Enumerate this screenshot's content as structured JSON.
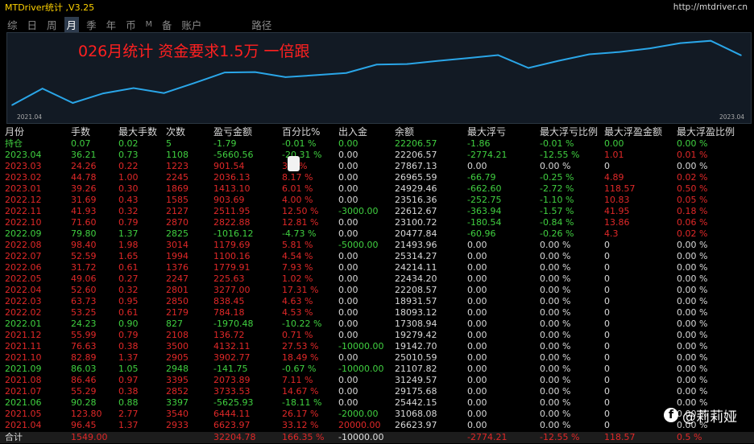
{
  "window": {
    "title": "MTDriver统计 ,V3.25",
    "url": "http://mtdriver.cn"
  },
  "tabs": [
    {
      "label": "综",
      "active": false,
      "small": false
    },
    {
      "label": "日",
      "active": false,
      "small": false
    },
    {
      "label": "周",
      "active": false,
      "small": false
    },
    {
      "label": "月",
      "active": true,
      "small": false
    },
    {
      "label": "季",
      "active": false,
      "small": false
    },
    {
      "label": "年",
      "active": false,
      "small": false
    },
    {
      "label": "币",
      "active": false,
      "small": false
    },
    {
      "label": "M",
      "active": false,
      "small": true
    },
    {
      "label": "备",
      "active": false,
      "small": false
    },
    {
      "label": "账户",
      "active": false,
      "small": false
    },
    {
      "label": "路径",
      "active": false,
      "small": false
    }
  ],
  "chart_data": {
    "type": "line",
    "title": "026月统计 资金要求1.5万 一倍跟",
    "x_start_label": "2021.04",
    "x_end_label": "2023.04",
    "line_color": "#2aa6e8",
    "x": [
      "2021.04",
      "2021.05",
      "2021.06",
      "2021.07",
      "2021.08",
      "2021.09",
      "2021.10",
      "2021.11",
      "2021.12",
      "2022.01",
      "2022.02",
      "2022.03",
      "2022.04",
      "2022.05",
      "2022.06",
      "2022.07",
      "2022.08",
      "2022.09",
      "2022.10",
      "2022.11",
      "2022.12",
      "2023.01",
      "2023.02",
      "2023.03",
      "2023.04"
    ],
    "values": [
      6623.97,
      13068.08,
      7442.15,
      11175.68,
      13249.6,
      11325.43,
      15228.17,
      19360.28,
      19497.14,
      17526.66,
      18311.54,
      19149.99,
      22427.06,
      22652.82,
      23832.75,
      24933.81,
      26113.47,
      21113.47,
      23936.35,
      26448.3,
      27352.23,
      28765.58,
      30801.71,
      31703.25,
      26042.69
    ],
    "ylim": [
      4000,
      33500
    ]
  },
  "table": {
    "headers": [
      "月份",
      "手数",
      "最大手数",
      "次数",
      "盈亏金额",
      "百分比%",
      "出入金",
      "余额",
      "最大浮亏",
      "最大浮亏比例",
      "最大浮盈金额",
      "最大浮盈比例"
    ],
    "holding": [
      "持仓",
      "0.07",
      "0.02",
      "5",
      "-1.79",
      "-0.01 %",
      "0.00",
      "22206.57",
      "-1.86",
      "-0.01 %",
      "0.00",
      "0.00 %"
    ],
    "rows": [
      {
        "sign": "neg",
        "cells": [
          "2023.04",
          "36.21",
          "0.73",
          "1108",
          "-5660.56",
          "-20.31 %",
          "0.00",
          "22206.57",
          "-2774.21",
          "-12.55 %",
          "1.01",
          "0.01 %"
        ]
      },
      {
        "sign": "pos",
        "cells": [
          "2023.03",
          "24.26",
          "0.22",
          "1223",
          "901.54",
          "3.3 %",
          "0.00",
          "27867.13",
          "0.00",
          "0.00 %",
          "0",
          "0.00 %"
        ]
      },
      {
        "sign": "pos",
        "cells": [
          "2023.02",
          "44.78",
          "1.00",
          "2245",
          "2036.13",
          "8.17 %",
          "0.00",
          "26965.59",
          "-66.79",
          "-0.25 %",
          "4.89",
          "0.02 %"
        ]
      },
      {
        "sign": "pos",
        "cells": [
          "2023.01",
          "39.26",
          "0.30",
          "1869",
          "1413.10",
          "6.01 %",
          "0.00",
          "24929.46",
          "-662.60",
          "-2.72 %",
          "118.57",
          "0.50 %"
        ]
      },
      {
        "sign": "pos",
        "cells": [
          "2022.12",
          "31.69",
          "0.43",
          "1585",
          "903.69",
          "4.00 %",
          "0.00",
          "23516.36",
          "-252.75",
          "-1.10 %",
          "10.83",
          "0.05 %"
        ]
      },
      {
        "sign": "pos",
        "cells": [
          "2022.11",
          "41.93",
          "0.32",
          "2127",
          "2511.95",
          "12.50 %",
          "-3000.00",
          "22612.67",
          "-363.94",
          "-1.57 %",
          "41.95",
          "0.18 %"
        ]
      },
      {
        "sign": "pos",
        "cells": [
          "2022.10",
          "71.60",
          "0.79",
          "2870",
          "2822.88",
          "12.81 %",
          "0.00",
          "23100.72",
          "-180.54",
          "-0.84 %",
          "13.86",
          "0.06 %"
        ]
      },
      {
        "sign": "neg",
        "cells": [
          "2022.09",
          "79.80",
          "1.37",
          "2825",
          "-1016.12",
          "-4.73 %",
          "0.00",
          "20477.84",
          "-60.96",
          "-0.26 %",
          "4.3",
          "0.02 %"
        ]
      },
      {
        "sign": "pos",
        "cells": [
          "2022.08",
          "98.40",
          "1.98",
          "3014",
          "1179.69",
          "5.81 %",
          "-5000.00",
          "21493.96",
          "0.00",
          "0.00 %",
          "0",
          "0.00 %"
        ]
      },
      {
        "sign": "pos",
        "cells": [
          "2022.07",
          "52.59",
          "1.65",
          "1994",
          "1100.16",
          "4.54 %",
          "0.00",
          "25314.27",
          "0.00",
          "0.00 %",
          "0",
          "0.00 %"
        ]
      },
      {
        "sign": "pos",
        "cells": [
          "2022.06",
          "31.72",
          "0.61",
          "1376",
          "1779.91",
          "7.93 %",
          "0.00",
          "24214.11",
          "0.00",
          "0.00 %",
          "0",
          "0.00 %"
        ]
      },
      {
        "sign": "pos",
        "cells": [
          "2022.05",
          "49.06",
          "0.27",
          "2247",
          "225.63",
          "1.02 %",
          "0.00",
          "22434.20",
          "0.00",
          "0.00 %",
          "0",
          "0.00 %"
        ]
      },
      {
        "sign": "pos",
        "cells": [
          "2022.04",
          "52.60",
          "0.32",
          "2801",
          "3277.00",
          "17.31 %",
          "0.00",
          "22208.57",
          "0.00",
          "0.00 %",
          "0",
          "0.00 %"
        ]
      },
      {
        "sign": "pos",
        "cells": [
          "2022.03",
          "63.73",
          "0.95",
          "2850",
          "838.45",
          "4.63 %",
          "0.00",
          "18931.57",
          "0.00",
          "0.00 %",
          "0",
          "0.00 %"
        ]
      },
      {
        "sign": "pos",
        "cells": [
          "2022.02",
          "53.25",
          "0.61",
          "2179",
          "784.18",
          "4.53 %",
          "0.00",
          "18093.12",
          "0.00",
          "0.00 %",
          "0",
          "0.00 %"
        ]
      },
      {
        "sign": "neg",
        "cells": [
          "2022.01",
          "24.23",
          "0.90",
          "827",
          "-1970.48",
          "-10.22 %",
          "0.00",
          "17308.94",
          "0.00",
          "0.00 %",
          "0",
          "0.00 %"
        ]
      },
      {
        "sign": "pos",
        "cells": [
          "2021.12",
          "55.99",
          "0.79",
          "2108",
          "136.72",
          "0.71 %",
          "0.00",
          "19279.42",
          "0.00",
          "0.00 %",
          "0",
          "0.00 %"
        ]
      },
      {
        "sign": "pos",
        "cells": [
          "2021.11",
          "76.63",
          "0.38",
          "3500",
          "4132.11",
          "27.53 %",
          "-10000.00",
          "19142.70",
          "0.00",
          "0.00 %",
          "0",
          "0.00 %"
        ]
      },
      {
        "sign": "pos",
        "cells": [
          "2021.10",
          "82.89",
          "1.37",
          "2905",
          "3902.77",
          "18.49 %",
          "0.00",
          "25010.59",
          "0.00",
          "0.00 %",
          "0",
          "0.00 %"
        ]
      },
      {
        "sign": "neg",
        "cells": [
          "2021.09",
          "86.03",
          "1.05",
          "2948",
          "-141.75",
          "-0.67 %",
          "-10000.00",
          "21107.82",
          "0.00",
          "0.00 %",
          "0",
          "0.00 %"
        ]
      },
      {
        "sign": "pos",
        "cells": [
          "2021.08",
          "86.46",
          "0.97",
          "3395",
          "2073.89",
          "7.11 %",
          "0.00",
          "31249.57",
          "0.00",
          "0.00 %",
          "0",
          "0.00 %"
        ]
      },
      {
        "sign": "pos",
        "cells": [
          "2021.07",
          "55.29",
          "0.38",
          "2852",
          "3733.53",
          "14.67 %",
          "0.00",
          "29175.68",
          "0.00",
          "0.00 %",
          "0",
          "0.00 %"
        ]
      },
      {
        "sign": "neg",
        "cells": [
          "2021.06",
          "90.28",
          "0.88",
          "3397",
          "-5625.93",
          "-18.11 %",
          "0.00",
          "25442.15",
          "0.00",
          "0.00 %",
          "0",
          "0.00 %"
        ]
      },
      {
        "sign": "pos",
        "cells": [
          "2021.05",
          "123.80",
          "2.77",
          "3540",
          "6444.11",
          "26.17 %",
          "-2000.00",
          "31068.08",
          "0.00",
          "0.00 %",
          "0",
          "0.00 %"
        ]
      },
      {
        "sign": "pos",
        "cells": [
          "2021.04",
          "96.45",
          "1.37",
          "2933",
          "6623.97",
          "33.12 %",
          "20000.00",
          "26623.97",
          "0.00",
          "0.00 %",
          "0",
          "0.00 %"
        ]
      }
    ],
    "total": [
      "合计",
      "1549.00",
      "",
      "",
      "32204.78",
      "166.35 %",
      "-10000.00",
      "",
      "-2774.21",
      "-12.55 %",
      "118.57",
      "0.5 %"
    ]
  },
  "watermark": {
    "icon": "facebook-icon",
    "text": "@莉莉娅"
  }
}
